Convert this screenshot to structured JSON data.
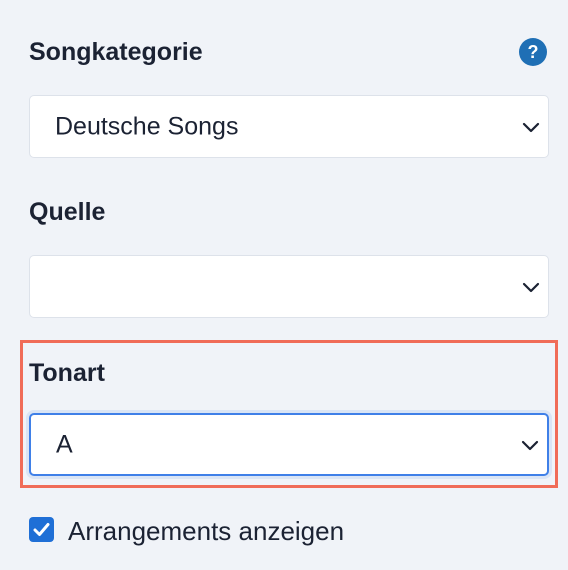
{
  "fields": {
    "category": {
      "label": "Songkategorie",
      "value": "Deutsche Songs",
      "help_icon": "question-icon",
      "help_glyph": "?"
    },
    "source": {
      "label": "Quelle",
      "value": ""
    },
    "key": {
      "label": "Tonart",
      "value": "A"
    }
  },
  "options": {
    "show_arrangements": {
      "label": "Arrangements anzeigen",
      "checked": true
    }
  },
  "colors": {
    "accent": "#1f6fd6",
    "help": "#1f6fb5",
    "highlight": "#f06c58",
    "background": "#f0f3f8"
  }
}
